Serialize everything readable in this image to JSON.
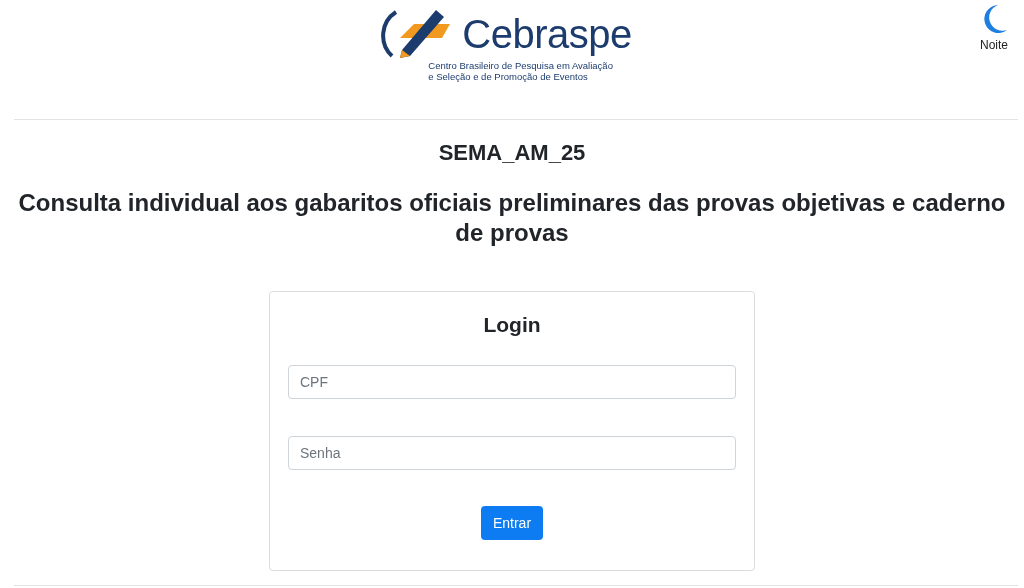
{
  "header": {
    "logo": {
      "name": "Cebraspe",
      "subtitle_lines": [
        "Centro Brasileiro de Pesquisa em Avaliação",
        "e Seleção e de Promoção de Eventos"
      ]
    },
    "theme_toggle": {
      "label": "Noite"
    }
  },
  "exam_code": "SEMA_AM_25",
  "heading": "Consulta individual aos gabaritos oficiais preliminares das provas objetivas e caderno de provas",
  "login": {
    "title": "Login",
    "fields": [
      {
        "placeholder": "CPF"
      },
      {
        "placeholder": "Senha"
      }
    ],
    "button": "Entrar"
  }
}
